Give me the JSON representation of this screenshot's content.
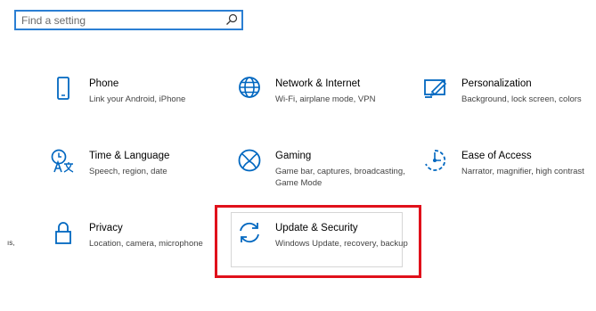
{
  "search": {
    "placeholder": "Find a setting"
  },
  "edge_text": "ıs,",
  "tiles": [
    {
      "name": "Phone",
      "desc": "Link your Android, iPhone",
      "icon": "phone-icon"
    },
    {
      "name": "Network & Internet",
      "desc": "Wi-Fi, airplane mode, VPN",
      "icon": "globe-icon"
    },
    {
      "name": "Personalization",
      "desc": "Background, lock screen, colors",
      "icon": "paint-brush-icon"
    },
    {
      "name": "Time & Language",
      "desc": "Speech, region, date",
      "icon": "time-language-icon"
    },
    {
      "name": "Gaming",
      "desc": "Game bar, captures, broadcasting, Game Mode",
      "icon": "xbox-icon"
    },
    {
      "name": "Ease of Access",
      "desc": "Narrator, magnifier, high contrast",
      "icon": "ease-of-access-icon"
    },
    {
      "name": "Privacy",
      "desc": "Location, camera, microphone",
      "icon": "lock-icon"
    },
    {
      "name": "Update & Security",
      "desc": "Windows Update, recovery, backup",
      "icon": "sync-icon"
    }
  ],
  "colors": {
    "accent": "#0067c0",
    "highlight": "#e0111b",
    "search_border": "#2b7fd3"
  }
}
